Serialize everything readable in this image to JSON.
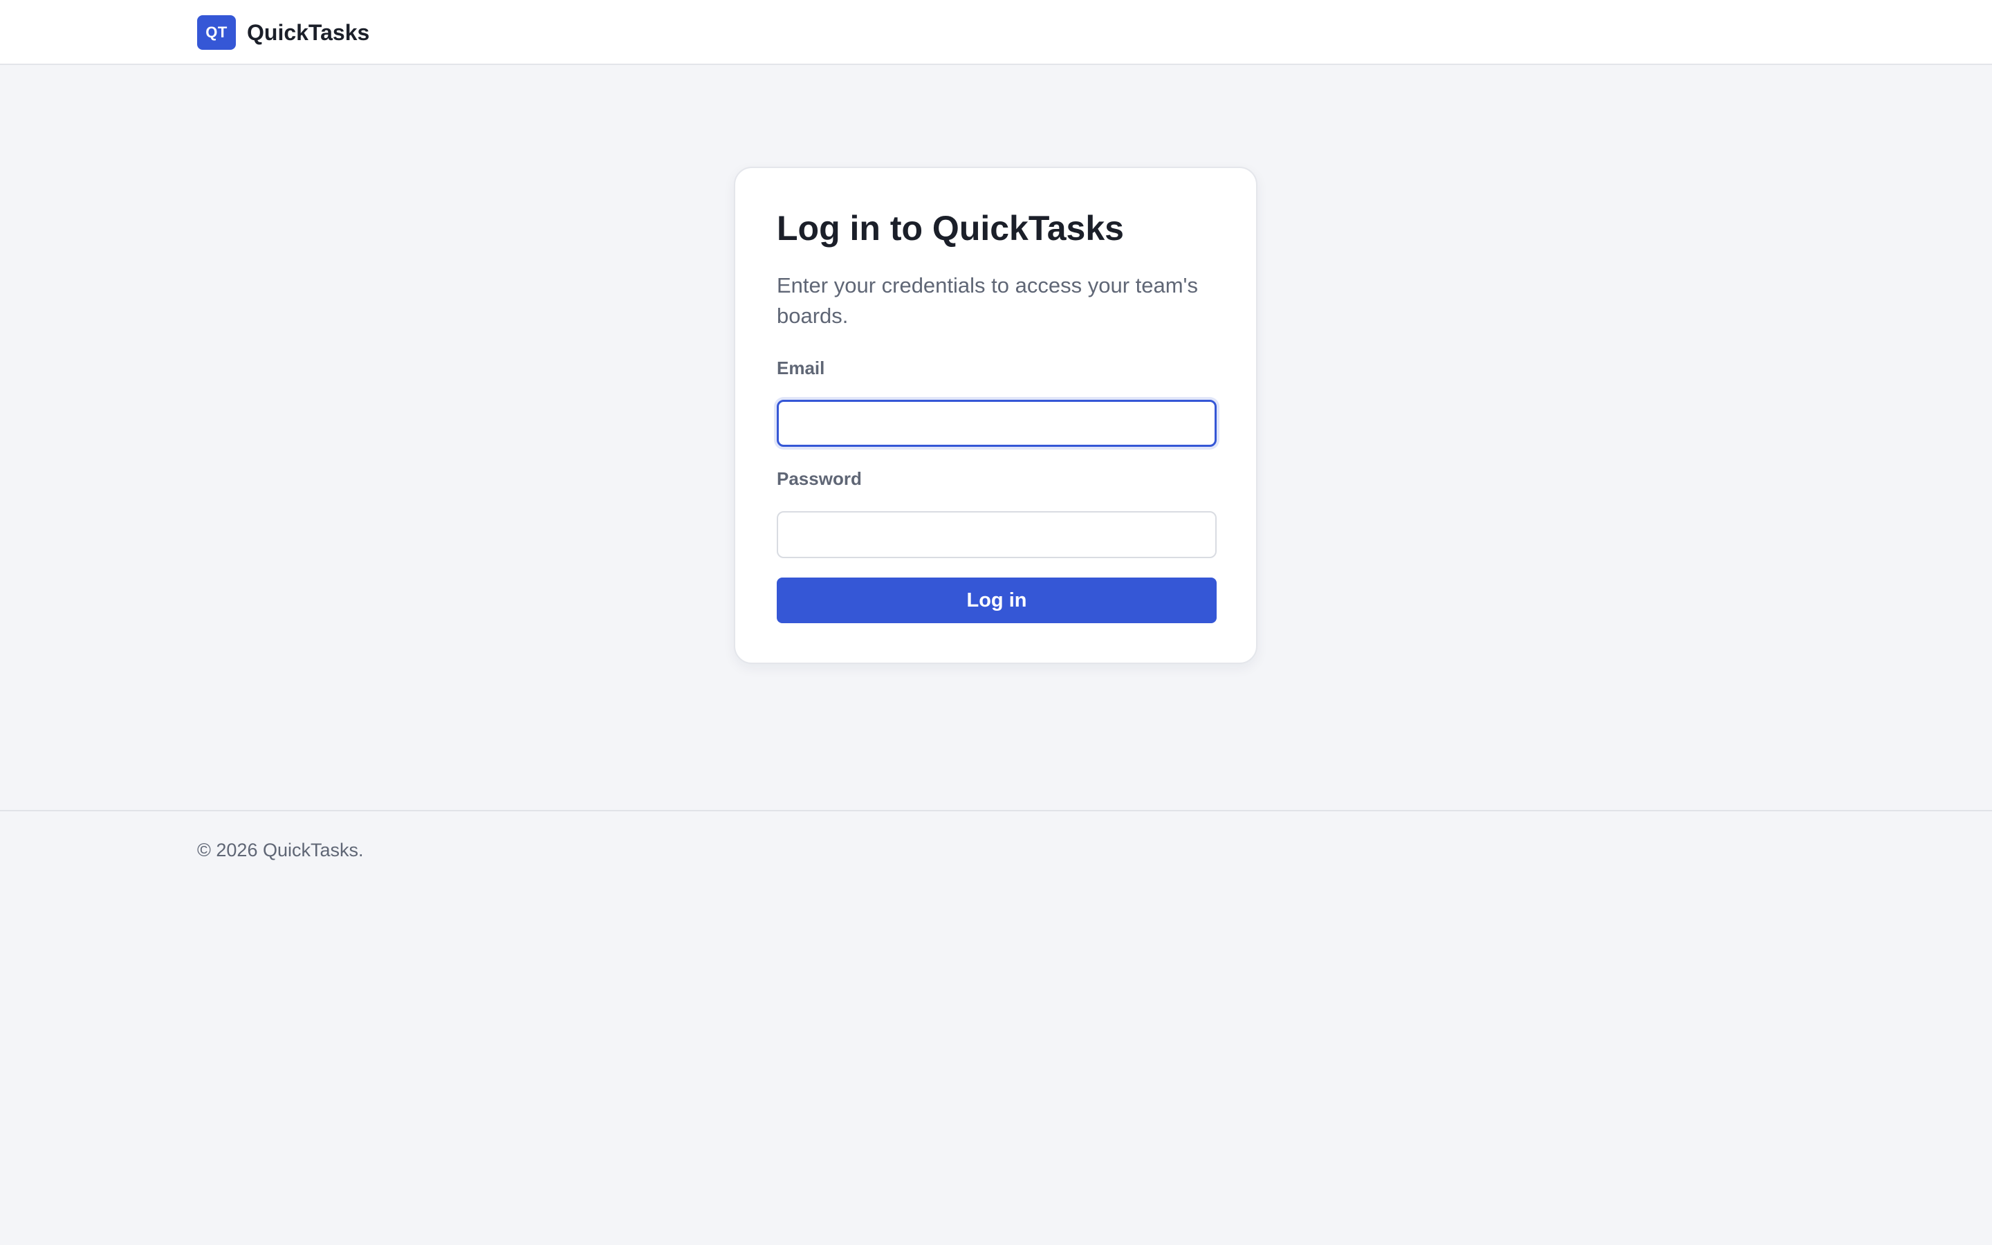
{
  "header": {
    "logo_text": "QT",
    "brand_name": "QuickTasks"
  },
  "login": {
    "title": "Log in to QuickTasks",
    "subtitle": "Enter your credentials to access your team's boards.",
    "email_label": "Email",
    "email_value": "",
    "password_label": "Password",
    "password_value": "",
    "submit_label": "Log in"
  },
  "footer": {
    "copyright": "© 2026 QuickTasks."
  },
  "colors": {
    "accent": "#3557d6",
    "page_background": "#f4f5f8",
    "card_background": "#ffffff",
    "muted_text": "#5f6675",
    "heading_text": "#1b1f29"
  }
}
